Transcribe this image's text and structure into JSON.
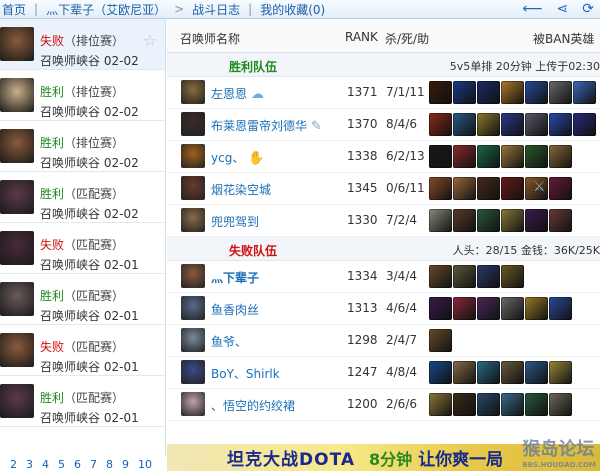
{
  "topbar": {
    "crumb_home": "首页",
    "crumb_player": "灬下辈子（艾欧尼亚）",
    "crumb_log": "战斗日志",
    "crumb_fav": "我的收藏(0)",
    "icons": [
      "back-arrow-icon",
      "share-icon",
      "refresh-icon"
    ]
  },
  "matches": [
    {
      "result": "失败",
      "type": "lose",
      "mode": "（排位赛）",
      "map": "召唤师峡谷",
      "date": "02-02",
      "color": "#8a5a3a"
    },
    {
      "result": "胜利",
      "type": "win",
      "mode": "（排位赛）",
      "map": "召唤师峡谷",
      "date": "02-02",
      "color": "#c9b08a"
    },
    {
      "result": "胜利",
      "type": "win",
      "mode": "（排位赛）",
      "map": "召唤师峡谷",
      "date": "02-02",
      "color": "#8a5a3a"
    },
    {
      "result": "胜利",
      "type": "win",
      "mode": "（匹配赛）",
      "map": "召唤师峡谷",
      "date": "02-02",
      "color": "#5a3a4a"
    },
    {
      "result": "失败",
      "type": "lose",
      "mode": "（匹配赛）",
      "map": "召唤师峡谷",
      "date": "02-01",
      "color": "#4a2a3a"
    },
    {
      "result": "胜利",
      "type": "win",
      "mode": "（匹配赛）",
      "map": "召唤师峡谷",
      "date": "02-01",
      "color": "#6a5a5a"
    },
    {
      "result": "失败",
      "type": "lose",
      "mode": "（匹配赛）",
      "map": "召唤师峡谷",
      "date": "02-01",
      "color": "#8a5a3a"
    },
    {
      "result": "胜利",
      "type": "win",
      "mode": "（匹配赛）",
      "map": "召唤师峡谷",
      "date": "02-01",
      "color": "#5a3a4a"
    }
  ],
  "pager": [
    "2",
    "3",
    "4",
    "5",
    "6",
    "7",
    "8",
    "9",
    "10"
  ],
  "columns": {
    "name": "召唤师名称",
    "rank": "RANK",
    "kda": "杀/死/助",
    "ban": "被BAN英雄"
  },
  "win_team": {
    "label": "胜利队伍",
    "info": "5v5单排  20分钟  上传于02:30",
    "players": [
      {
        "name": "左恩恩",
        "rank": "1371",
        "kda": "7/1/11",
        "color": "#8a6a3a",
        "icon": "cloud-icon",
        "items": [
          "#3a1a0a",
          "#1a3a8a",
          "#1a2a6a",
          "#b07a2a",
          "#2a4a9a",
          "#6a6a6a",
          "#3a6ac0"
        ]
      },
      {
        "name": "布莱恩雷帝刘德华",
        "rank": "1370",
        "kda": "8/4/6",
        "color": "#3a2a2a",
        "icon": "feather-icon",
        "items": [
          "#8a2a1a",
          "#2a5a8a",
          "#8a7a2a",
          "#2a3a8a",
          "#5a5a6a",
          "#2a4ab0",
          "#2a2a7a"
        ]
      },
      {
        "name": "ycg、",
        "rank": "1338",
        "kda": "6/2/13",
        "color": "#a0601a",
        "icon": "hand-icon",
        "items": [
          "#1a1a1a",
          "#8a2a2a",
          "#1a6a4a",
          "#9a7a3a",
          "#2a5a2a",
          "#8a6a3a"
        ]
      },
      {
        "name": "烟花染空城",
        "rank": "1345",
        "kda": "0/6/11",
        "color": "#6a3a2a",
        "icon": "",
        "items": [
          "#8a4a2a",
          "#9a6a3a",
          "#4a2a1a",
          "#6a1a1a",
          "#8a5a2a",
          "#6a1a3a"
        ]
      },
      {
        "name": "兜兜驾到",
        "rank": "1330",
        "kda": "7/2/4",
        "color": "#8a6a4a",
        "icon": "",
        "items": [
          "#8a8a7a",
          "#5a3a2a",
          "#2a5a3a",
          "#8a7a3a",
          "#3a1a4a",
          "#6a3a3a"
        ]
      }
    ]
  },
  "lose_team": {
    "label": "失败队伍",
    "info": "人头：28/15  金钱：36K/25K",
    "players": [
      {
        "name": "灬下辈子",
        "rank": "1334",
        "kda": "3/4/4",
        "color": "#8a5a3a",
        "me": true,
        "items": [
          "#6a4a2a",
          "#5a5a3a",
          "#2a3a6a",
          "#6a5a2a"
        ]
      },
      {
        "name": "鱼香肉丝",
        "rank": "1313",
        "kda": "4/6/4",
        "color": "#5a6a8a",
        "items": [
          "#3a1a4a",
          "#8a2a3a",
          "#4a2a5a",
          "#6a6a6a",
          "#9a7a2a",
          "#2a4a9a"
        ]
      },
      {
        "name": "鱼爷、",
        "rank": "1298",
        "kda": "2/4/7",
        "color": "#7a8a9a",
        "items": [
          "#6a4a2a"
        ]
      },
      {
        "name": "BoY、Shirlk",
        "rank": "1247",
        "kda": "4/8/4",
        "color": "#3a4a8a",
        "items": [
          "#1a4a8a",
          "#8a6a4a",
          "#2a6a8a",
          "#6a5a3a",
          "#2a5a8a",
          "#9a8a3a"
        ]
      },
      {
        "name": "、悟空的约绞裙",
        "rank": "1200",
        "kda": "2/6/6",
        "color": "#c0a0b0",
        "items": [
          "#8a7a3a",
          "#3a2a1a",
          "#2a4a6a",
          "#3a6a8a",
          "#2a5a3a",
          "#6a6a5a"
        ]
      }
    ]
  },
  "banner": {
    "part1": "坦克大战DOTA",
    "part2": "8分钟",
    "part3": "让你爽一局"
  },
  "watermark": "猴岛论坛",
  "watermark_url": "BBS.HOUDAO.COM"
}
